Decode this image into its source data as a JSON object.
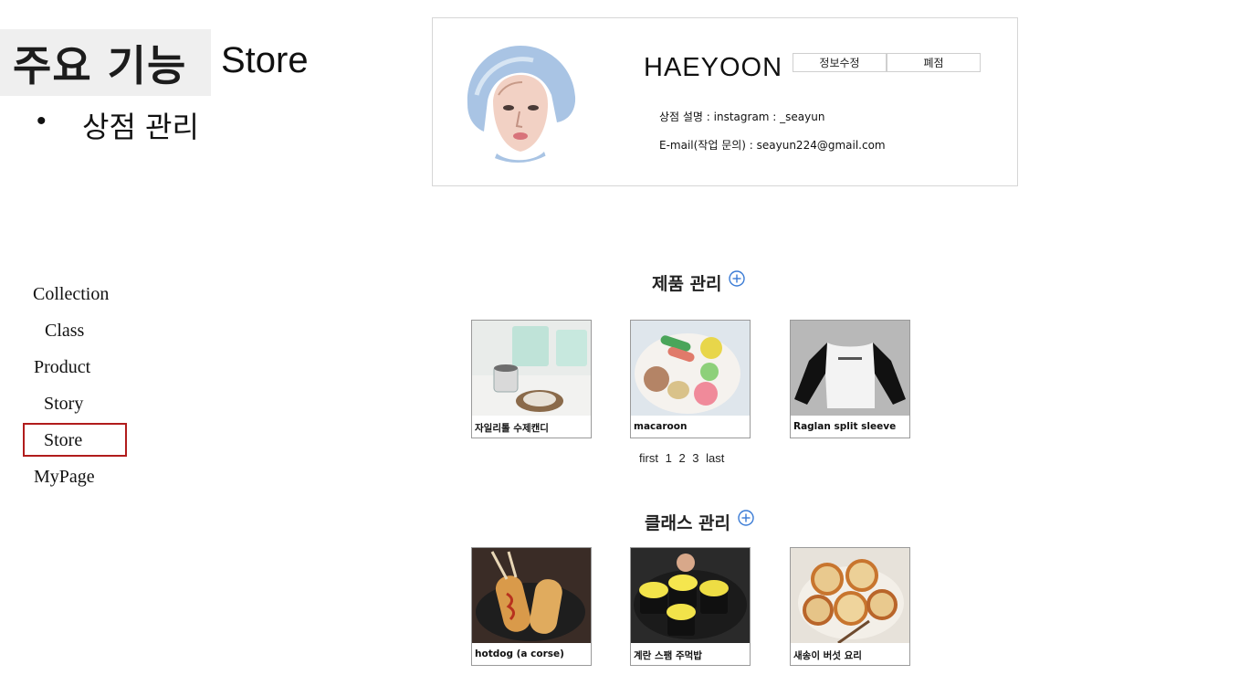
{
  "slide": {
    "title": "주요 기능",
    "subtitle": "Store",
    "bullet": "•",
    "bullet_text": "상점 관리"
  },
  "profile": {
    "store_name": "HAEYOON",
    "edit_button": "정보수정",
    "close_button": "폐점",
    "description": "상점 설명 : instagram : _seayun",
    "email": "E-mail(작업 문의) : seayun224@gmail.com"
  },
  "nav": {
    "items": [
      {
        "label": "Collection"
      },
      {
        "label": "Class"
      },
      {
        "label": "Product"
      },
      {
        "label": "Story"
      },
      {
        "label": "Store"
      },
      {
        "label": "MyPage"
      }
    ],
    "active": "Store"
  },
  "products": {
    "title": "제품 관리",
    "items": [
      {
        "name": "자일리톨 수제캔디"
      },
      {
        "name": "macaroon"
      },
      {
        "name": "Raglan split sleeve"
      }
    ],
    "pager": {
      "first": "first",
      "pages": [
        "1",
        "2",
        "3"
      ],
      "last": "last"
    }
  },
  "classes": {
    "title": "클래스 관리",
    "items": [
      {
        "name": "hotdog (a corse)"
      },
      {
        "name": "계란 스팸 주먹밥"
      },
      {
        "name": "새송이 버섯 요리"
      }
    ]
  },
  "colors": {
    "highlight_border": "#b11c1c",
    "add_icon": "#3a7bd5",
    "title_box": "#efefef"
  },
  "icons": {
    "add": "plus-circle-icon",
    "bullet": "bullet-icon"
  }
}
